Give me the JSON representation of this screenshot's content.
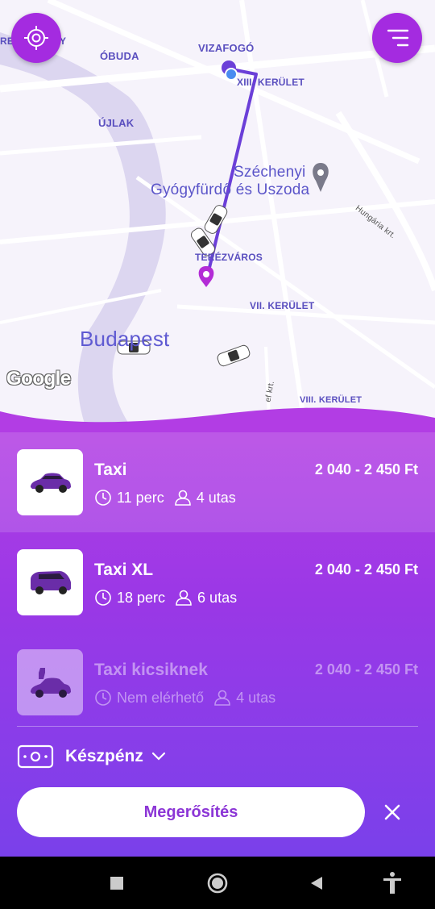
{
  "map": {
    "labels": {
      "obuda": "ÓBUDA",
      "vizafogo": "VIZAFOGÓ",
      "xiii": "XIII. KERÜLET",
      "ujlak": "ÚJLAK",
      "szechenyi": "Széchenyi",
      "gyogyfurdo": "Gyógyfürdő és Uszoda",
      "terezvaros": "TERÉZVÁROS",
      "vii": "VII. KERÜLET",
      "budapest": "Budapest",
      "viii": "VIII. KERÜLET",
      "hungaria": "Hungária krt.",
      "edge_left": "RE",
      "edge_y": "Y",
      "jozsef": "ef krt."
    },
    "google": "Google"
  },
  "colors": {
    "accent": "#a42be0",
    "panel_top": "#b23de4",
    "panel_bottom": "#7a40ea",
    "route": "#6b3fd8"
  },
  "rides": [
    {
      "name": "Taxi",
      "price": "2 040 - 2 450 Ft",
      "time": "11 perc",
      "seats": "4 utas",
      "selected": true
    },
    {
      "name": "Taxi XL",
      "price": "2 040 - 2 450 Ft",
      "time": "18 perc",
      "seats": "6 utas",
      "selected": false
    },
    {
      "name": "Taxi kicsiknek",
      "price": "2 040 - 2 450 Ft",
      "time": "Nem elérhető",
      "seats": "4 utas",
      "disabled": true
    }
  ],
  "payment": {
    "label": "Készpénz",
    "icon": "cash-icon"
  },
  "confirm_label": "Megerősítés",
  "icons": {
    "locate": "crosshair-icon",
    "menu": "menu-icon",
    "close": "close-icon"
  }
}
